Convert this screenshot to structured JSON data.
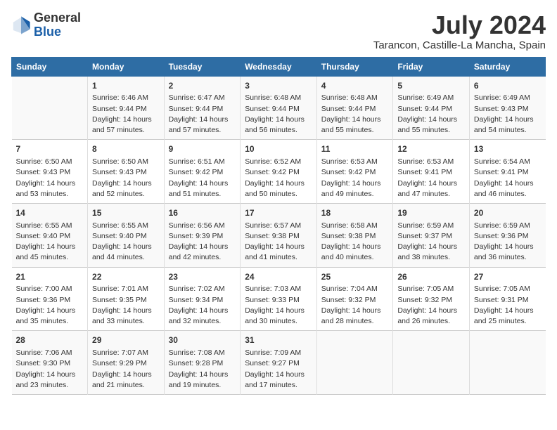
{
  "logo": {
    "general": "General",
    "blue": "Blue"
  },
  "title": "July 2024",
  "subtitle": "Tarancon, Castille-La Mancha, Spain",
  "days": [
    "Sunday",
    "Monday",
    "Tuesday",
    "Wednesday",
    "Thursday",
    "Friday",
    "Saturday"
  ],
  "weeks": [
    [
      {
        "num": "",
        "sunrise": "",
        "sunset": "",
        "daylight": ""
      },
      {
        "num": "1",
        "sunrise": "Sunrise: 6:46 AM",
        "sunset": "Sunset: 9:44 PM",
        "daylight": "Daylight: 14 hours and 57 minutes."
      },
      {
        "num": "2",
        "sunrise": "Sunrise: 6:47 AM",
        "sunset": "Sunset: 9:44 PM",
        "daylight": "Daylight: 14 hours and 57 minutes."
      },
      {
        "num": "3",
        "sunrise": "Sunrise: 6:48 AM",
        "sunset": "Sunset: 9:44 PM",
        "daylight": "Daylight: 14 hours and 56 minutes."
      },
      {
        "num": "4",
        "sunrise": "Sunrise: 6:48 AM",
        "sunset": "Sunset: 9:44 PM",
        "daylight": "Daylight: 14 hours and 55 minutes."
      },
      {
        "num": "5",
        "sunrise": "Sunrise: 6:49 AM",
        "sunset": "Sunset: 9:44 PM",
        "daylight": "Daylight: 14 hours and 55 minutes."
      },
      {
        "num": "6",
        "sunrise": "Sunrise: 6:49 AM",
        "sunset": "Sunset: 9:43 PM",
        "daylight": "Daylight: 14 hours and 54 minutes."
      }
    ],
    [
      {
        "num": "7",
        "sunrise": "Sunrise: 6:50 AM",
        "sunset": "Sunset: 9:43 PM",
        "daylight": "Daylight: 14 hours and 53 minutes."
      },
      {
        "num": "8",
        "sunrise": "Sunrise: 6:50 AM",
        "sunset": "Sunset: 9:43 PM",
        "daylight": "Daylight: 14 hours and 52 minutes."
      },
      {
        "num": "9",
        "sunrise": "Sunrise: 6:51 AM",
        "sunset": "Sunset: 9:42 PM",
        "daylight": "Daylight: 14 hours and 51 minutes."
      },
      {
        "num": "10",
        "sunrise": "Sunrise: 6:52 AM",
        "sunset": "Sunset: 9:42 PM",
        "daylight": "Daylight: 14 hours and 50 minutes."
      },
      {
        "num": "11",
        "sunrise": "Sunrise: 6:53 AM",
        "sunset": "Sunset: 9:42 PM",
        "daylight": "Daylight: 14 hours and 49 minutes."
      },
      {
        "num": "12",
        "sunrise": "Sunrise: 6:53 AM",
        "sunset": "Sunset: 9:41 PM",
        "daylight": "Daylight: 14 hours and 47 minutes."
      },
      {
        "num": "13",
        "sunrise": "Sunrise: 6:54 AM",
        "sunset": "Sunset: 9:41 PM",
        "daylight": "Daylight: 14 hours and 46 minutes."
      }
    ],
    [
      {
        "num": "14",
        "sunrise": "Sunrise: 6:55 AM",
        "sunset": "Sunset: 9:40 PM",
        "daylight": "Daylight: 14 hours and 45 minutes."
      },
      {
        "num": "15",
        "sunrise": "Sunrise: 6:55 AM",
        "sunset": "Sunset: 9:40 PM",
        "daylight": "Daylight: 14 hours and 44 minutes."
      },
      {
        "num": "16",
        "sunrise": "Sunrise: 6:56 AM",
        "sunset": "Sunset: 9:39 PM",
        "daylight": "Daylight: 14 hours and 42 minutes."
      },
      {
        "num": "17",
        "sunrise": "Sunrise: 6:57 AM",
        "sunset": "Sunset: 9:38 PM",
        "daylight": "Daylight: 14 hours and 41 minutes."
      },
      {
        "num": "18",
        "sunrise": "Sunrise: 6:58 AM",
        "sunset": "Sunset: 9:38 PM",
        "daylight": "Daylight: 14 hours and 40 minutes."
      },
      {
        "num": "19",
        "sunrise": "Sunrise: 6:59 AM",
        "sunset": "Sunset: 9:37 PM",
        "daylight": "Daylight: 14 hours and 38 minutes."
      },
      {
        "num": "20",
        "sunrise": "Sunrise: 6:59 AM",
        "sunset": "Sunset: 9:36 PM",
        "daylight": "Daylight: 14 hours and 36 minutes."
      }
    ],
    [
      {
        "num": "21",
        "sunrise": "Sunrise: 7:00 AM",
        "sunset": "Sunset: 9:36 PM",
        "daylight": "Daylight: 14 hours and 35 minutes."
      },
      {
        "num": "22",
        "sunrise": "Sunrise: 7:01 AM",
        "sunset": "Sunset: 9:35 PM",
        "daylight": "Daylight: 14 hours and 33 minutes."
      },
      {
        "num": "23",
        "sunrise": "Sunrise: 7:02 AM",
        "sunset": "Sunset: 9:34 PM",
        "daylight": "Daylight: 14 hours and 32 minutes."
      },
      {
        "num": "24",
        "sunrise": "Sunrise: 7:03 AM",
        "sunset": "Sunset: 9:33 PM",
        "daylight": "Daylight: 14 hours and 30 minutes."
      },
      {
        "num": "25",
        "sunrise": "Sunrise: 7:04 AM",
        "sunset": "Sunset: 9:32 PM",
        "daylight": "Daylight: 14 hours and 28 minutes."
      },
      {
        "num": "26",
        "sunrise": "Sunrise: 7:05 AM",
        "sunset": "Sunset: 9:32 PM",
        "daylight": "Daylight: 14 hours and 26 minutes."
      },
      {
        "num": "27",
        "sunrise": "Sunrise: 7:05 AM",
        "sunset": "Sunset: 9:31 PM",
        "daylight": "Daylight: 14 hours and 25 minutes."
      }
    ],
    [
      {
        "num": "28",
        "sunrise": "Sunrise: 7:06 AM",
        "sunset": "Sunset: 9:30 PM",
        "daylight": "Daylight: 14 hours and 23 minutes."
      },
      {
        "num": "29",
        "sunrise": "Sunrise: 7:07 AM",
        "sunset": "Sunset: 9:29 PM",
        "daylight": "Daylight: 14 hours and 21 minutes."
      },
      {
        "num": "30",
        "sunrise": "Sunrise: 7:08 AM",
        "sunset": "Sunset: 9:28 PM",
        "daylight": "Daylight: 14 hours and 19 minutes."
      },
      {
        "num": "31",
        "sunrise": "Sunrise: 7:09 AM",
        "sunset": "Sunset: 9:27 PM",
        "daylight": "Daylight: 14 hours and 17 minutes."
      },
      {
        "num": "",
        "sunrise": "",
        "sunset": "",
        "daylight": ""
      },
      {
        "num": "",
        "sunrise": "",
        "sunset": "",
        "daylight": ""
      },
      {
        "num": "",
        "sunrise": "",
        "sunset": "",
        "daylight": ""
      }
    ]
  ]
}
